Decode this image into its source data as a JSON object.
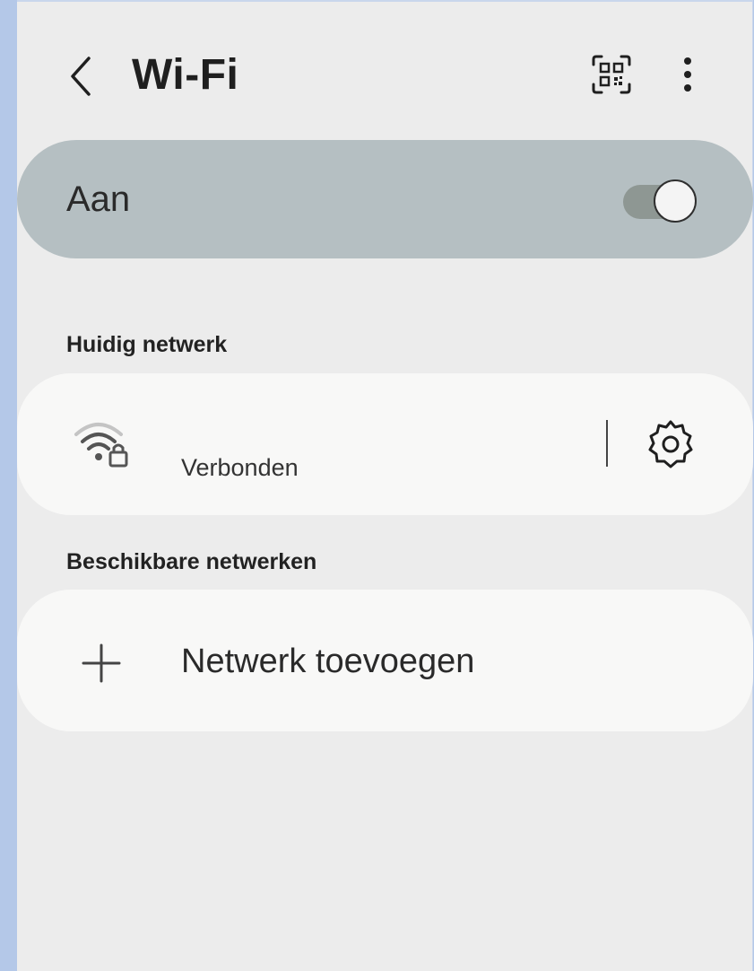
{
  "header": {
    "title": "Wi-Fi",
    "back_icon": "chevron-left-icon",
    "qr_icon": "qr-code-scan-icon",
    "more_icon": "more-vertical-icon"
  },
  "master_switch": {
    "label": "Aan",
    "checked": true
  },
  "current_network": {
    "section_title": "Huidig netwerk",
    "status": "Verbonden",
    "icon": "wifi-lock-icon",
    "settings_icon": "gear-icon"
  },
  "available_networks": {
    "section_title": "Beschikbare netwerken",
    "add_label": "Netwerk toevoegen",
    "add_icon": "plus-icon"
  },
  "colors": {
    "background": "#ececec",
    "toggle_bar": "#b5bfc2",
    "card": "#f8f8f7",
    "switch_track": "#8e9793"
  }
}
